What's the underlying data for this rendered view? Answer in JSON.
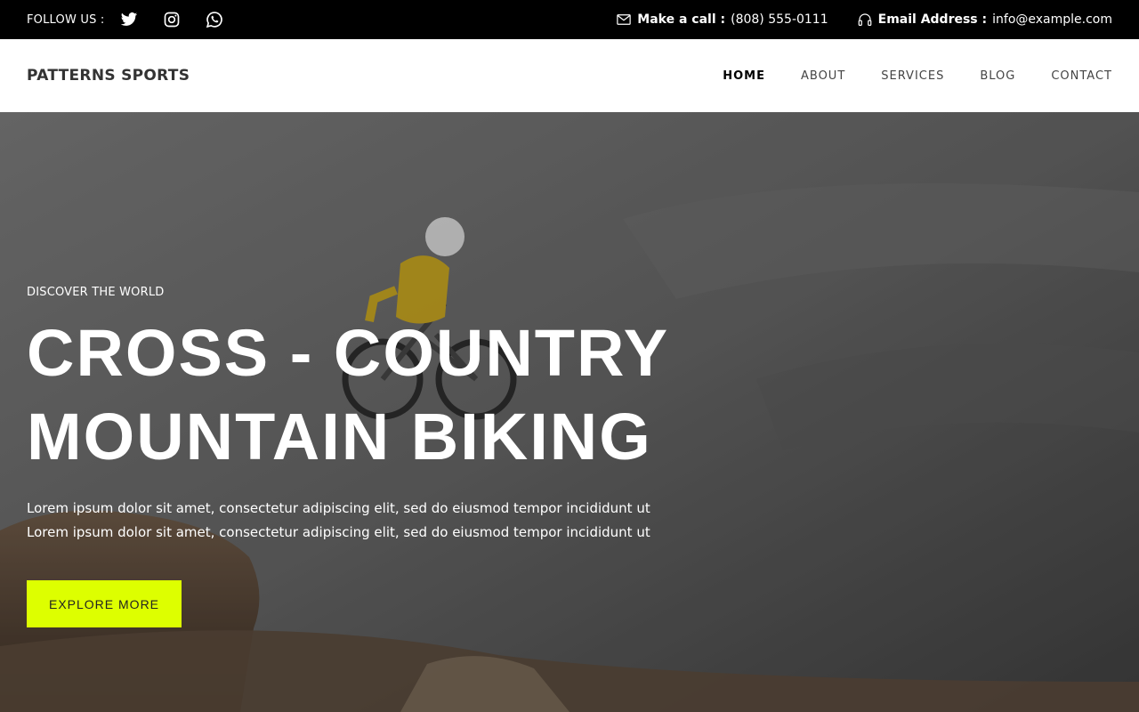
{
  "topbar": {
    "follow_label": "FOLLOW US :",
    "social": [
      {
        "icon": "twitter-icon"
      },
      {
        "icon": "instagram-icon"
      },
      {
        "icon": "whatsapp-icon"
      }
    ],
    "call_label": "Make a call :",
    "call_value": "(808) 555-0111",
    "email_label": "Email Address :",
    "email_value": "info@example.com"
  },
  "header": {
    "logo": "PATTERNS SPORTS",
    "nav": [
      "HOME",
      "ABOUT",
      "SERVICES",
      "BLOG",
      "CONTACT"
    ],
    "active_nav": "HOME"
  },
  "hero": {
    "eyebrow": "DISCOVER THE WORLD",
    "headline_line1": "CROSS - COUNTRY",
    "headline_line2": "MOUNTAIN BIKING",
    "desc_line1": "Lorem ipsum dolor sit amet, consectetur adipiscing elit, sed do eiusmod tempor incididunt ut",
    "desc_line2": "Lorem ipsum dolor sit amet, consectetur adipiscing elit, sed do eiusmod tempor incididunt ut",
    "cta": "EXPLORE MORE",
    "accent_color": "#ddff00"
  }
}
